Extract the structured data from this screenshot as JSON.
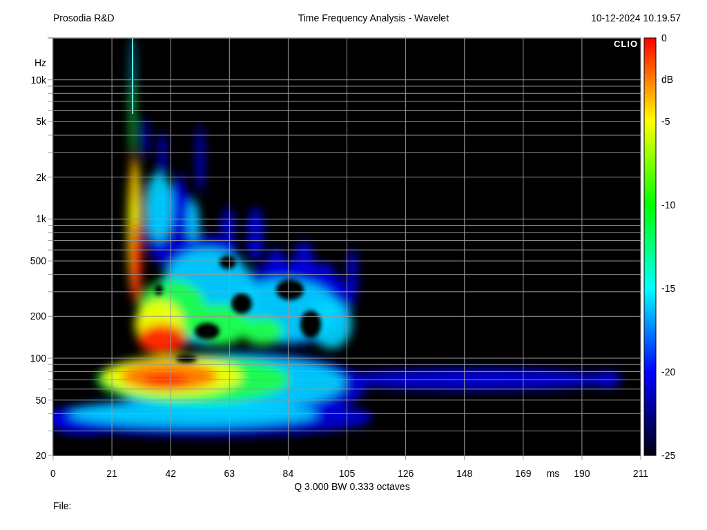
{
  "header": {
    "company": "Prosodia R&D",
    "title": "Time Frequency Analysis - Wavelet",
    "timestamp": "10-12-2024 10.19.57"
  },
  "logo": "CLIO",
  "y_axis": {
    "unit": "Hz",
    "labels": [
      "10k",
      "5k",
      "2k",
      "1k",
      "500",
      "200",
      "100",
      "50",
      "20"
    ]
  },
  "x_axis": {
    "unit": "ms",
    "labels": [
      "0",
      "21",
      "42",
      "63",
      "84",
      "105",
      "126",
      "148",
      "169",
      "190",
      "211"
    ],
    "caption": "Q 3.000 BW 0.333 octaves"
  },
  "colorbar": {
    "unit": "dB",
    "labels": [
      "0",
      "-5",
      "-10",
      "-15",
      "-20",
      "-25"
    ]
  },
  "footer": {
    "file_label": "File:"
  }
}
